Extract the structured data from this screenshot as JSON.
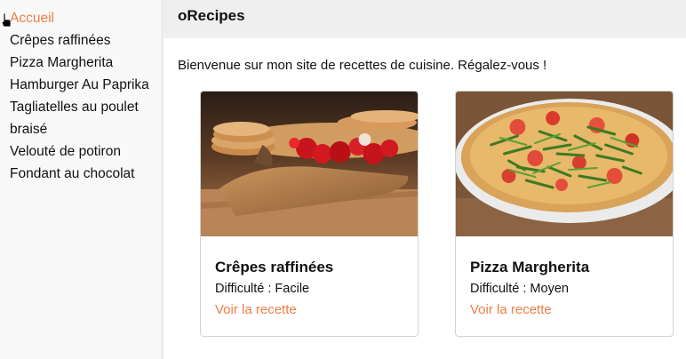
{
  "sidebar": {
    "items": [
      {
        "label": "Accueil",
        "active": true
      },
      {
        "label": "Crêpes raffinées"
      },
      {
        "label": "Pizza Margherita"
      },
      {
        "label": "Hamburger Au Paprika"
      },
      {
        "label": "Tagliatelles au poulet braisé"
      },
      {
        "label": "Velouté de potiron"
      },
      {
        "label": "Fondant au chocolat"
      }
    ]
  },
  "header": {
    "title": "oRecipes"
  },
  "main": {
    "intro": "Bienvenue sur mon site de recettes de cuisine. Régalez-vous !",
    "recipes": [
      {
        "title": "Crêpes raffinées",
        "difficulty": "Difficulté : Facile",
        "link_label": "Voir la recette",
        "image": "crepes-photo"
      },
      {
        "title": "Pizza Margherita",
        "difficulty": "Difficulté : Moyen",
        "link_label": "Voir la recette",
        "image": "pizza-photo"
      }
    ]
  },
  "colors": {
    "accent": "#ee7d45",
    "sidebar_bg": "#f9f9f9",
    "header_bg": "#efefef"
  }
}
